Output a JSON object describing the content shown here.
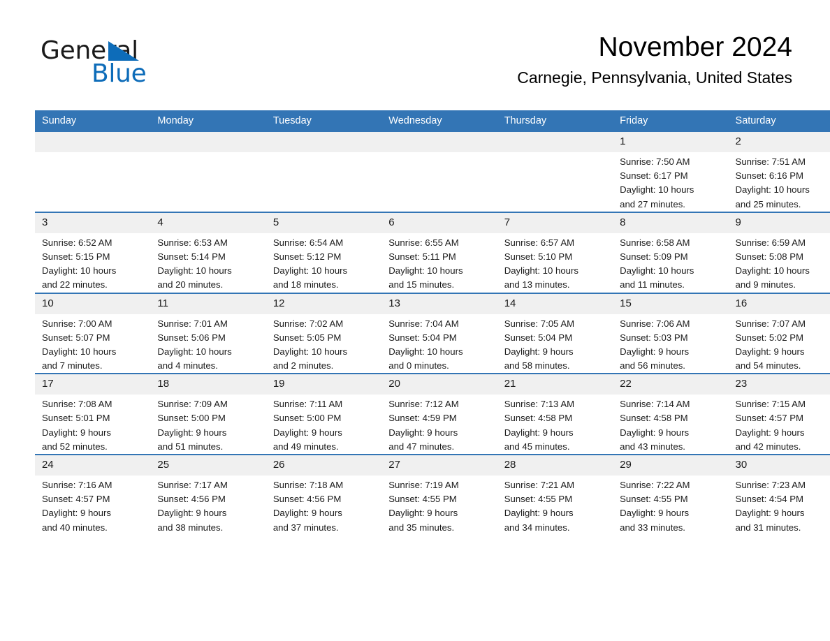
{
  "brand": {
    "name_part1": "General",
    "name_part2": "Blue",
    "triangle_icon": "triangle-icon",
    "accent_color": "#0d6cb9"
  },
  "header": {
    "month_title": "November 2024",
    "location": "Carnegie, Pennsylvania, United States"
  },
  "theme": {
    "header_bg": "#3375b5",
    "daynum_bg": "#f0f0f0",
    "row_border": "#3375b5",
    "text": "#1a1a1a"
  },
  "calendar": {
    "weekday_headers": [
      "Sunday",
      "Monday",
      "Tuesday",
      "Wednesday",
      "Thursday",
      "Friday",
      "Saturday"
    ],
    "weeks": [
      [
        {
          "day": "",
          "empty": true,
          "sunrise": "",
          "sunset": "",
          "daylight_line1": "",
          "daylight_line2": ""
        },
        {
          "day": "",
          "empty": true,
          "sunrise": "",
          "sunset": "",
          "daylight_line1": "",
          "daylight_line2": ""
        },
        {
          "day": "",
          "empty": true,
          "sunrise": "",
          "sunset": "",
          "daylight_line1": "",
          "daylight_line2": ""
        },
        {
          "day": "",
          "empty": true,
          "sunrise": "",
          "sunset": "",
          "daylight_line1": "",
          "daylight_line2": ""
        },
        {
          "day": "",
          "empty": true,
          "sunrise": "",
          "sunset": "",
          "daylight_line1": "",
          "daylight_line2": ""
        },
        {
          "day": "1",
          "empty": false,
          "sunrise": "Sunrise: 7:50 AM",
          "sunset": "Sunset: 6:17 PM",
          "daylight_line1": "Daylight: 10 hours",
          "daylight_line2": "and 27 minutes."
        },
        {
          "day": "2",
          "empty": false,
          "sunrise": "Sunrise: 7:51 AM",
          "sunset": "Sunset: 6:16 PM",
          "daylight_line1": "Daylight: 10 hours",
          "daylight_line2": "and 25 minutes."
        }
      ],
      [
        {
          "day": "3",
          "empty": false,
          "sunrise": "Sunrise: 6:52 AM",
          "sunset": "Sunset: 5:15 PM",
          "daylight_line1": "Daylight: 10 hours",
          "daylight_line2": "and 22 minutes."
        },
        {
          "day": "4",
          "empty": false,
          "sunrise": "Sunrise: 6:53 AM",
          "sunset": "Sunset: 5:14 PM",
          "daylight_line1": "Daylight: 10 hours",
          "daylight_line2": "and 20 minutes."
        },
        {
          "day": "5",
          "empty": false,
          "sunrise": "Sunrise: 6:54 AM",
          "sunset": "Sunset: 5:12 PM",
          "daylight_line1": "Daylight: 10 hours",
          "daylight_line2": "and 18 minutes."
        },
        {
          "day": "6",
          "empty": false,
          "sunrise": "Sunrise: 6:55 AM",
          "sunset": "Sunset: 5:11 PM",
          "daylight_line1": "Daylight: 10 hours",
          "daylight_line2": "and 15 minutes."
        },
        {
          "day": "7",
          "empty": false,
          "sunrise": "Sunrise: 6:57 AM",
          "sunset": "Sunset: 5:10 PM",
          "daylight_line1": "Daylight: 10 hours",
          "daylight_line2": "and 13 minutes."
        },
        {
          "day": "8",
          "empty": false,
          "sunrise": "Sunrise: 6:58 AM",
          "sunset": "Sunset: 5:09 PM",
          "daylight_line1": "Daylight: 10 hours",
          "daylight_line2": "and 11 minutes."
        },
        {
          "day": "9",
          "empty": false,
          "sunrise": "Sunrise: 6:59 AM",
          "sunset": "Sunset: 5:08 PM",
          "daylight_line1": "Daylight: 10 hours",
          "daylight_line2": "and 9 minutes."
        }
      ],
      [
        {
          "day": "10",
          "empty": false,
          "sunrise": "Sunrise: 7:00 AM",
          "sunset": "Sunset: 5:07 PM",
          "daylight_line1": "Daylight: 10 hours",
          "daylight_line2": "and 7 minutes."
        },
        {
          "day": "11",
          "empty": false,
          "sunrise": "Sunrise: 7:01 AM",
          "sunset": "Sunset: 5:06 PM",
          "daylight_line1": "Daylight: 10 hours",
          "daylight_line2": "and 4 minutes."
        },
        {
          "day": "12",
          "empty": false,
          "sunrise": "Sunrise: 7:02 AM",
          "sunset": "Sunset: 5:05 PM",
          "daylight_line1": "Daylight: 10 hours",
          "daylight_line2": "and 2 minutes."
        },
        {
          "day": "13",
          "empty": false,
          "sunrise": "Sunrise: 7:04 AM",
          "sunset": "Sunset: 5:04 PM",
          "daylight_line1": "Daylight: 10 hours",
          "daylight_line2": "and 0 minutes."
        },
        {
          "day": "14",
          "empty": false,
          "sunrise": "Sunrise: 7:05 AM",
          "sunset": "Sunset: 5:04 PM",
          "daylight_line1": "Daylight: 9 hours",
          "daylight_line2": "and 58 minutes."
        },
        {
          "day": "15",
          "empty": false,
          "sunrise": "Sunrise: 7:06 AM",
          "sunset": "Sunset: 5:03 PM",
          "daylight_line1": "Daylight: 9 hours",
          "daylight_line2": "and 56 minutes."
        },
        {
          "day": "16",
          "empty": false,
          "sunrise": "Sunrise: 7:07 AM",
          "sunset": "Sunset: 5:02 PM",
          "daylight_line1": "Daylight: 9 hours",
          "daylight_line2": "and 54 minutes."
        }
      ],
      [
        {
          "day": "17",
          "empty": false,
          "sunrise": "Sunrise: 7:08 AM",
          "sunset": "Sunset: 5:01 PM",
          "daylight_line1": "Daylight: 9 hours",
          "daylight_line2": "and 52 minutes."
        },
        {
          "day": "18",
          "empty": false,
          "sunrise": "Sunrise: 7:09 AM",
          "sunset": "Sunset: 5:00 PM",
          "daylight_line1": "Daylight: 9 hours",
          "daylight_line2": "and 51 minutes."
        },
        {
          "day": "19",
          "empty": false,
          "sunrise": "Sunrise: 7:11 AM",
          "sunset": "Sunset: 5:00 PM",
          "daylight_line1": "Daylight: 9 hours",
          "daylight_line2": "and 49 minutes."
        },
        {
          "day": "20",
          "empty": false,
          "sunrise": "Sunrise: 7:12 AM",
          "sunset": "Sunset: 4:59 PM",
          "daylight_line1": "Daylight: 9 hours",
          "daylight_line2": "and 47 minutes."
        },
        {
          "day": "21",
          "empty": false,
          "sunrise": "Sunrise: 7:13 AM",
          "sunset": "Sunset: 4:58 PM",
          "daylight_line1": "Daylight: 9 hours",
          "daylight_line2": "and 45 minutes."
        },
        {
          "day": "22",
          "empty": false,
          "sunrise": "Sunrise: 7:14 AM",
          "sunset": "Sunset: 4:58 PM",
          "daylight_line1": "Daylight: 9 hours",
          "daylight_line2": "and 43 minutes."
        },
        {
          "day": "23",
          "empty": false,
          "sunrise": "Sunrise: 7:15 AM",
          "sunset": "Sunset: 4:57 PM",
          "daylight_line1": "Daylight: 9 hours",
          "daylight_line2": "and 42 minutes."
        }
      ],
      [
        {
          "day": "24",
          "empty": false,
          "sunrise": "Sunrise: 7:16 AM",
          "sunset": "Sunset: 4:57 PM",
          "daylight_line1": "Daylight: 9 hours",
          "daylight_line2": "and 40 minutes."
        },
        {
          "day": "25",
          "empty": false,
          "sunrise": "Sunrise: 7:17 AM",
          "sunset": "Sunset: 4:56 PM",
          "daylight_line1": "Daylight: 9 hours",
          "daylight_line2": "and 38 minutes."
        },
        {
          "day": "26",
          "empty": false,
          "sunrise": "Sunrise: 7:18 AM",
          "sunset": "Sunset: 4:56 PM",
          "daylight_line1": "Daylight: 9 hours",
          "daylight_line2": "and 37 minutes."
        },
        {
          "day": "27",
          "empty": false,
          "sunrise": "Sunrise: 7:19 AM",
          "sunset": "Sunset: 4:55 PM",
          "daylight_line1": "Daylight: 9 hours",
          "daylight_line2": "and 35 minutes."
        },
        {
          "day": "28",
          "empty": false,
          "sunrise": "Sunrise: 7:21 AM",
          "sunset": "Sunset: 4:55 PM",
          "daylight_line1": "Daylight: 9 hours",
          "daylight_line2": "and 34 minutes."
        },
        {
          "day": "29",
          "empty": false,
          "sunrise": "Sunrise: 7:22 AM",
          "sunset": "Sunset: 4:55 PM",
          "daylight_line1": "Daylight: 9 hours",
          "daylight_line2": "and 33 minutes."
        },
        {
          "day": "30",
          "empty": false,
          "sunrise": "Sunrise: 7:23 AM",
          "sunset": "Sunset: 4:54 PM",
          "daylight_line1": "Daylight: 9 hours",
          "daylight_line2": "and 31 minutes."
        }
      ]
    ]
  }
}
